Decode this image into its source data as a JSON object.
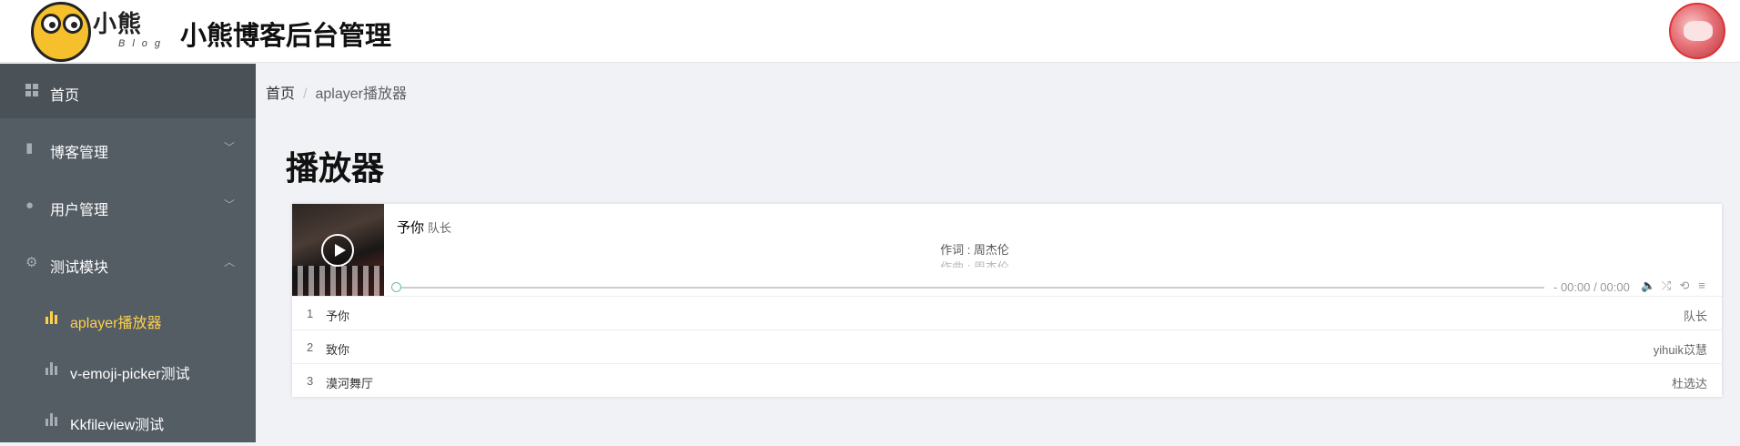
{
  "header": {
    "logo_text": "小熊",
    "logo_sub": "Blog",
    "title": "小熊博客后台管理"
  },
  "sidebar": {
    "items": [
      {
        "label": "首页",
        "icon": "grid-icon"
      },
      {
        "label": "博客管理",
        "icon": "book-icon"
      },
      {
        "label": "用户管理",
        "icon": "user-icon"
      },
      {
        "label": "测试模块",
        "icon": "gear-icon"
      }
    ],
    "sub_items": [
      {
        "label": "aplayer播放器",
        "active": true
      },
      {
        "label": "v-emoji-picker测试"
      },
      {
        "label": "Kkfileview测试"
      }
    ],
    "active_color": "#ffd04b"
  },
  "breadcrumb": {
    "home": "首页",
    "sep": "/",
    "current": "aplayer播放器"
  },
  "page": {
    "title": "播放器"
  },
  "player": {
    "song": "予你",
    "artist": "队长",
    "lrc_line1": "作词 : 周杰伦",
    "lrc_line2": "作曲 : 周杰伦",
    "time": "- 00:00 / 00:00",
    "progress": 0,
    "theme_color": "#6cbf94",
    "playlist": [
      {
        "index": "1",
        "name": "予你",
        "artist": "队长"
      },
      {
        "index": "2",
        "name": "致你",
        "artist": "yihuik苡慧"
      },
      {
        "index": "3",
        "name": "漠河舞厅",
        "artist": "杜选达"
      }
    ]
  }
}
